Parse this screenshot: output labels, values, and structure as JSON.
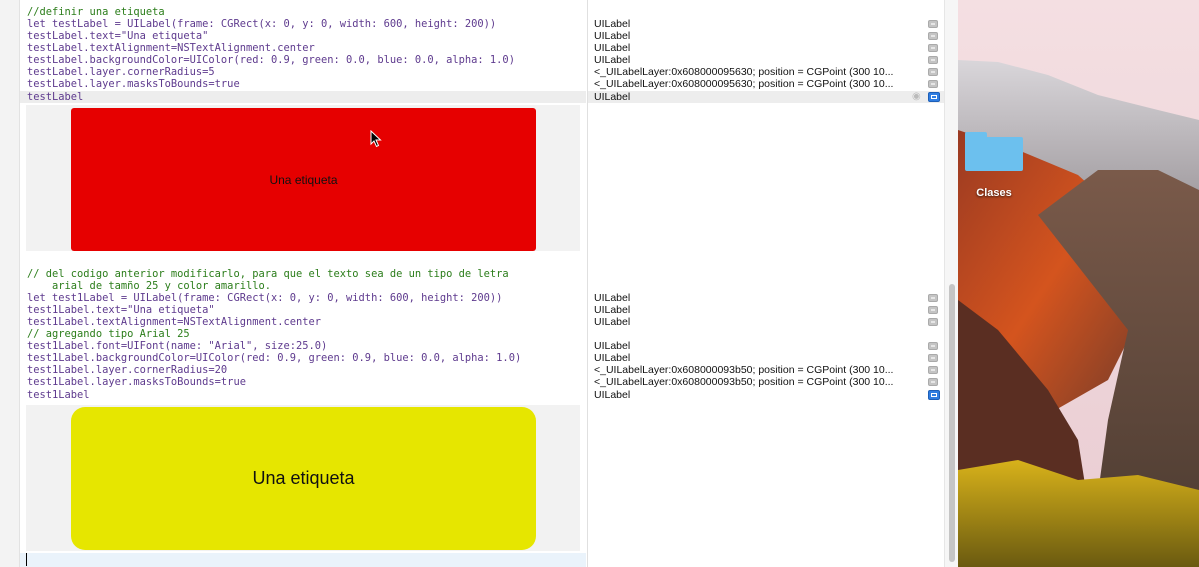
{
  "editor": {
    "block1": [
      {
        "text": "//definir una etiqueta",
        "kind": "comment"
      },
      {
        "text": "let testLabel = UILabel(frame: CGRect(x: 0, y: 0, width: 600, height: 200))",
        "kind": "code"
      },
      {
        "text": "testLabel.text=\"Una etiqueta\"",
        "kind": "code"
      },
      {
        "text": "testLabel.textAlignment=NSTextAlignment.center",
        "kind": "code"
      },
      {
        "text": "testLabel.backgroundColor=UIColor(red: 0.9, green: 0.0, blue: 0.0, alpha: 1.0)",
        "kind": "code"
      },
      {
        "text": "testLabel.layer.cornerRadius=5",
        "kind": "code"
      },
      {
        "text": "testLabel.layer.masksToBounds=true",
        "kind": "code"
      },
      {
        "text": "testLabel",
        "kind": "code"
      }
    ],
    "block2": [
      {
        "text": "// del codigo anterior modificarlo, para que el texto sea de un tipo de letra",
        "kind": "comment"
      },
      {
        "text": "    arial de tamño 25 y color amarillo.",
        "kind": "comment"
      },
      {
        "text": "let test1Label = UILabel(frame: CGRect(x: 0, y: 0, width: 600, height: 200))",
        "kind": "code"
      },
      {
        "text": "test1Label.text=\"Una etiqueta\"",
        "kind": "code"
      },
      {
        "text": "test1Label.textAlignment=NSTextAlignment.center",
        "kind": "code"
      },
      {
        "text": "// agregando tipo Arial 25",
        "kind": "comment"
      },
      {
        "text": "test1Label.font=UIFont(name: \"Arial\", size:25.0)",
        "kind": "code"
      },
      {
        "text": "test1Label.backgroundColor=UIColor(red: 0.9, green: 0.9, blue: 0.0, alpha: 1.0)",
        "kind": "code"
      },
      {
        "text": "test1Label.layer.cornerRadius=20",
        "kind": "code"
      },
      {
        "text": "test1Label.layer.masksToBounds=true",
        "kind": "code"
      },
      {
        "text": "test1Label",
        "kind": "code"
      }
    ]
  },
  "results": {
    "block1": [
      "UILabel",
      "UILabel",
      "UILabel",
      "UILabel",
      "<_UILabelLayer:0x608000095630; position = CGPoint (300 10...",
      "<_UILabelLayer:0x608000095630; position = CGPoint (300 10...",
      "UILabel"
    ],
    "block2": [
      "UILabel",
      "UILabel",
      "UILabel",
      "UILabel",
      "UILabel",
      "<_UILabelLayer:0x608000093b50; position = CGPoint (300 10...",
      "<_UILabelLayer:0x608000093b50; position = CGPoint (300 10...",
      "UILabel"
    ]
  },
  "previews": {
    "red_label": {
      "text": "Una etiqueta",
      "color": "#e60000"
    },
    "yellow_label": {
      "text": "Una etiqueta",
      "color": "#e6e600"
    }
  },
  "desktop": {
    "folder_label": "Clases",
    "folder_color": "#6cc0ee"
  }
}
